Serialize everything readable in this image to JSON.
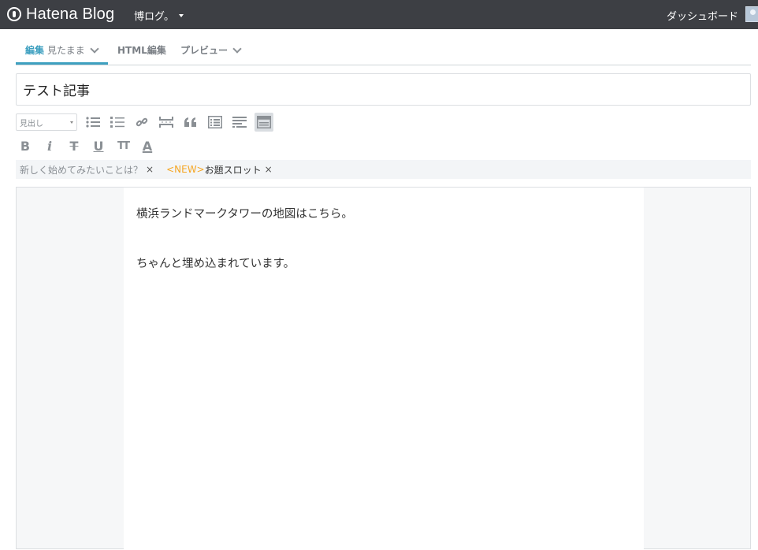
{
  "topbar": {
    "brand": "Hatena Blog",
    "blog_name": "博ログ。",
    "dashboard": "ダッシュボード",
    "background": "#3d3f44"
  },
  "tabs": {
    "edit": "編集",
    "edit_mode": "見たまま",
    "html": "HTML編集",
    "preview": "プレビュー",
    "active_color": "#3ea0c0"
  },
  "title": {
    "value": "テスト記事"
  },
  "toolbar": {
    "heading_select": "見出し",
    "icons": [
      "bullet-list-icon",
      "numbered-list-icon",
      "link-icon",
      "more-break-icon",
      "quote-icon",
      "table-of-contents-icon",
      "footnote-icon",
      "embed-box-icon",
      "bold-icon",
      "italic-icon",
      "strikethrough-icon",
      "underline-icon",
      "font-size-icon",
      "text-color-icon"
    ],
    "bold": "B",
    "italic": "i",
    "strike": "T",
    "underline": "U",
    "font_size": "TT",
    "color": "A"
  },
  "topics": {
    "topic1": "新しく始めてみたいことは？",
    "new_tag": "<NEW>",
    "topic2": "お題スロット",
    "close": "×"
  },
  "editor": {
    "paragraphs": [
      "横浜ランドマークタワーの地図はこちら。",
      "ちゃんと埋め込まれています。"
    ]
  }
}
